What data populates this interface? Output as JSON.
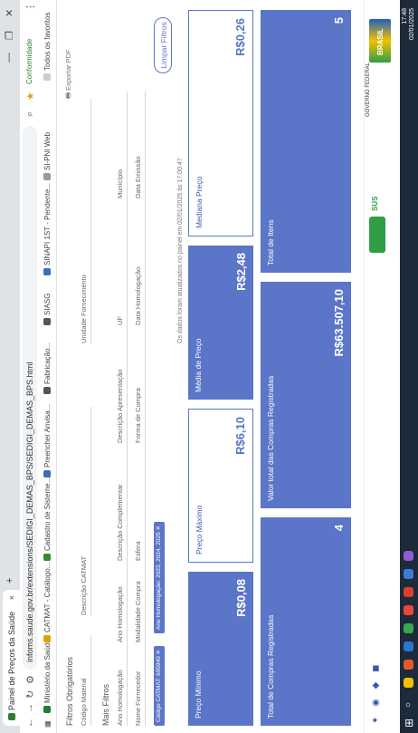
{
  "browser": {
    "tab_title": "Painel de Preços da Saúde",
    "new_tab": "+",
    "url": "infoms.saude.gov.br/extensions/SEDIGI_DEMAS_BPS/SEDIGI_DEMAS_BPS.html",
    "bookmarks": [
      {
        "label": "Ministério da Saúde",
        "color": "#1e7e34"
      },
      {
        "label": "CATMAT - Catálogo...",
        "color": "#d9a400"
      },
      {
        "label": "Cadastro de Sisteme...",
        "color": "#2d8f2d"
      },
      {
        "label": "Fabricação...",
        "color": "#888888"
      },
      {
        "label": "Preencher Anvisa...",
        "color": "#3a6fb7"
      },
      {
        "label": "SIASG",
        "color": "#555555"
      },
      {
        "label": "SINAPI 1ST - Pendente...",
        "color": "#3a6fb7"
      },
      {
        "label": "SI-PNI Web",
        "color": "#999999"
      }
    ],
    "other_favorites": "Todos os favoritos",
    "profile_label": "Conformidade"
  },
  "filters": {
    "required_title": "Filtros Obrigatórios",
    "more_title": "Mais Filtros",
    "collapse_icon": "−",
    "fields_row1": [
      "Código Material",
      "Descrição CATMAT",
      "Unidade Fornecimento"
    ],
    "fields_row2": [
      "Ano Homologação",
      "Ano Homologação",
      "Descrição Complementar",
      "Descrição Apresentação",
      "UF",
      "Município"
    ],
    "fields_row3": [
      "Nome Fornecedor",
      "Modalidade Compra",
      "Esfera",
      "Forma de Compra",
      "Data Homologação",
      "Data Emissão"
    ],
    "export_label": "Exportar PDF",
    "clear_button": "Limpar Filtros",
    "chips": [
      "Código CATMAT: 605940",
      "Ano Homologação: 2023, 2024, 2025"
    ],
    "update_note": "Os dados foram atualizados no painel em 02/01/2025 às 17:00:47"
  },
  "metrics": [
    {
      "title": "Preço Mínimo",
      "value": "R$0,08"
    },
    {
      "title": "Preço Máximo",
      "value": "R$6,10"
    },
    {
      "title": "Média de Preço",
      "value": "R$2,48"
    },
    {
      "title": "Mediana Preço",
      "value": "R$0,26"
    }
  ],
  "totals": [
    {
      "title": "Total de Compras Registradas",
      "value": "4"
    },
    {
      "title": "Valor total das Compras Registradas",
      "value": "R$63.507,10"
    },
    {
      "title": "Total de Itens",
      "value": "5"
    }
  ],
  "footer": {
    "left_label": "SUS",
    "right_label": "GOVERNO FEDERAL",
    "brand_text": "BRASIL"
  },
  "taskbar": {
    "time": "17:48",
    "date": "02/01/2025"
  },
  "colors": {
    "accent": "#5b76c8",
    "card_white_border": "#5b76c8",
    "taskbar": "#1d2a3a"
  }
}
